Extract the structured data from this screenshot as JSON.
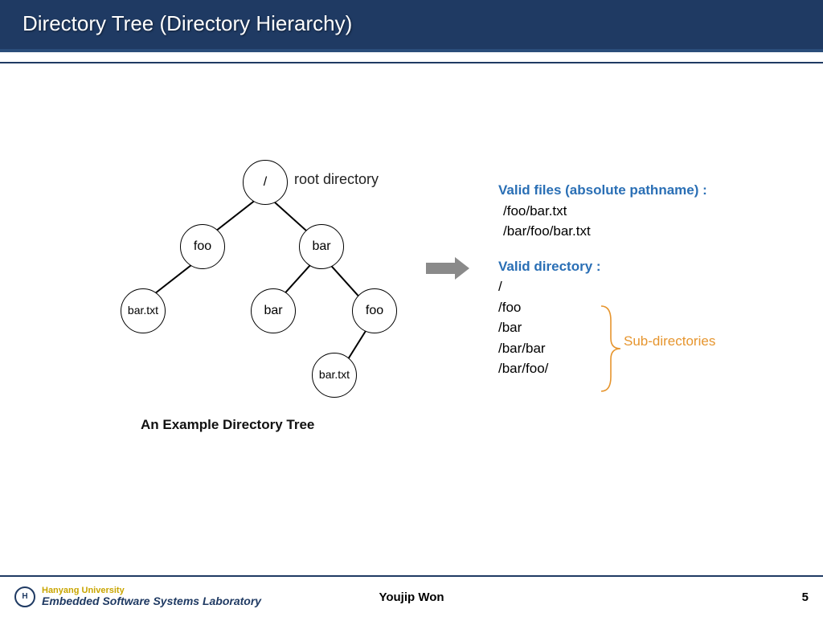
{
  "slide": {
    "title": "Directory Tree (Directory Hierarchy)",
    "caption": "An Example Directory Tree",
    "root_label": "root directory",
    "arrow_name": "right-arrow"
  },
  "tree": {
    "root": "/",
    "foo": "foo",
    "bar": "bar",
    "bartxt1": "bar.txt",
    "bar2": "bar",
    "foo2": "foo",
    "bartxt2": "bar.txt"
  },
  "right": {
    "files_heading": "Valid files (absolute pathname) :",
    "file1": "/foo/bar.txt",
    "file2": "/bar/foo/bar.txt",
    "dir_heading": "Valid directory :",
    "d1": "/",
    "d2": "/foo",
    "d3": "/bar",
    "d4": "/bar/bar",
    "d5": "/bar/foo/",
    "subdir_label": "Sub-directories"
  },
  "footer": {
    "university": "Hanyang University",
    "lab": "Embedded Software Systems Laboratory",
    "author": "Youjip Won",
    "page": "5"
  }
}
